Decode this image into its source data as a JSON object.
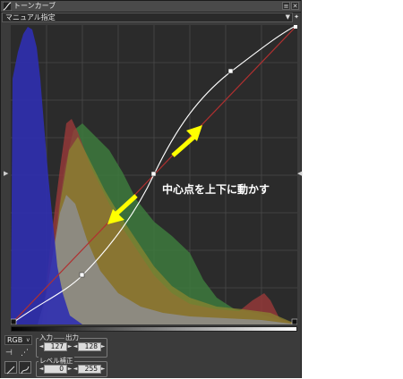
{
  "window": {
    "title": "トーンカーブ"
  },
  "titlebar_buttons": {
    "menu": "≡",
    "close": "✕"
  },
  "preset": {
    "value": "マニュアル指定",
    "arrow": "▼"
  },
  "pin_label": "✦",
  "graph": {
    "caption": "中心点を上下に動かす",
    "accent_colors": {
      "arrow": "#ffff00",
      "curve": "#ffffff",
      "diagonal": "#c0392b"
    },
    "histogram_colors": {
      "blue": "#2e2ea8",
      "red": "#b03a3a",
      "green": "#3f8a3f",
      "gray": "#8a8a8a"
    }
  },
  "channel": {
    "value": "RGB",
    "arrow": "v"
  },
  "io": {
    "input_label": "入力",
    "output_label": "出力",
    "input_value": "127",
    "output_value": "128"
  },
  "level": {
    "label": "レベル補正",
    "low": "0",
    "high": "255"
  },
  "spinners": {
    "left": "◄",
    "right": "►"
  }
}
